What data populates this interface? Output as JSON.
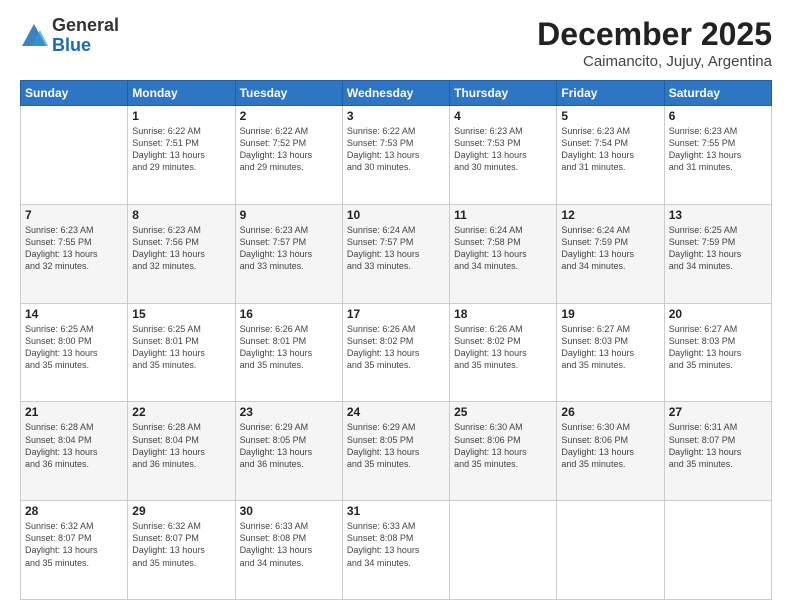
{
  "logo": {
    "general": "General",
    "blue": "Blue"
  },
  "header": {
    "month": "December 2025",
    "location": "Caimancito, Jujuy, Argentina"
  },
  "days_of_week": [
    "Sunday",
    "Monday",
    "Tuesday",
    "Wednesday",
    "Thursday",
    "Friday",
    "Saturday"
  ],
  "weeks": [
    [
      {
        "day": "",
        "info": ""
      },
      {
        "day": "1",
        "info": "Sunrise: 6:22 AM\nSunset: 7:51 PM\nDaylight: 13 hours\nand 29 minutes."
      },
      {
        "day": "2",
        "info": "Sunrise: 6:22 AM\nSunset: 7:52 PM\nDaylight: 13 hours\nand 29 minutes."
      },
      {
        "day": "3",
        "info": "Sunrise: 6:22 AM\nSunset: 7:53 PM\nDaylight: 13 hours\nand 30 minutes."
      },
      {
        "day": "4",
        "info": "Sunrise: 6:23 AM\nSunset: 7:53 PM\nDaylight: 13 hours\nand 30 minutes."
      },
      {
        "day": "5",
        "info": "Sunrise: 6:23 AM\nSunset: 7:54 PM\nDaylight: 13 hours\nand 31 minutes."
      },
      {
        "day": "6",
        "info": "Sunrise: 6:23 AM\nSunset: 7:55 PM\nDaylight: 13 hours\nand 31 minutes."
      }
    ],
    [
      {
        "day": "7",
        "info": "Sunrise: 6:23 AM\nSunset: 7:55 PM\nDaylight: 13 hours\nand 32 minutes."
      },
      {
        "day": "8",
        "info": "Sunrise: 6:23 AM\nSunset: 7:56 PM\nDaylight: 13 hours\nand 32 minutes."
      },
      {
        "day": "9",
        "info": "Sunrise: 6:23 AM\nSunset: 7:57 PM\nDaylight: 13 hours\nand 33 minutes."
      },
      {
        "day": "10",
        "info": "Sunrise: 6:24 AM\nSunset: 7:57 PM\nDaylight: 13 hours\nand 33 minutes."
      },
      {
        "day": "11",
        "info": "Sunrise: 6:24 AM\nSunset: 7:58 PM\nDaylight: 13 hours\nand 34 minutes."
      },
      {
        "day": "12",
        "info": "Sunrise: 6:24 AM\nSunset: 7:59 PM\nDaylight: 13 hours\nand 34 minutes."
      },
      {
        "day": "13",
        "info": "Sunrise: 6:25 AM\nSunset: 7:59 PM\nDaylight: 13 hours\nand 34 minutes."
      }
    ],
    [
      {
        "day": "14",
        "info": "Sunrise: 6:25 AM\nSunset: 8:00 PM\nDaylight: 13 hours\nand 35 minutes."
      },
      {
        "day": "15",
        "info": "Sunrise: 6:25 AM\nSunset: 8:01 PM\nDaylight: 13 hours\nand 35 minutes."
      },
      {
        "day": "16",
        "info": "Sunrise: 6:26 AM\nSunset: 8:01 PM\nDaylight: 13 hours\nand 35 minutes."
      },
      {
        "day": "17",
        "info": "Sunrise: 6:26 AM\nSunset: 8:02 PM\nDaylight: 13 hours\nand 35 minutes."
      },
      {
        "day": "18",
        "info": "Sunrise: 6:26 AM\nSunset: 8:02 PM\nDaylight: 13 hours\nand 35 minutes."
      },
      {
        "day": "19",
        "info": "Sunrise: 6:27 AM\nSunset: 8:03 PM\nDaylight: 13 hours\nand 35 minutes."
      },
      {
        "day": "20",
        "info": "Sunrise: 6:27 AM\nSunset: 8:03 PM\nDaylight: 13 hours\nand 35 minutes."
      }
    ],
    [
      {
        "day": "21",
        "info": "Sunrise: 6:28 AM\nSunset: 8:04 PM\nDaylight: 13 hours\nand 36 minutes."
      },
      {
        "day": "22",
        "info": "Sunrise: 6:28 AM\nSunset: 8:04 PM\nDaylight: 13 hours\nand 36 minutes."
      },
      {
        "day": "23",
        "info": "Sunrise: 6:29 AM\nSunset: 8:05 PM\nDaylight: 13 hours\nand 36 minutes."
      },
      {
        "day": "24",
        "info": "Sunrise: 6:29 AM\nSunset: 8:05 PM\nDaylight: 13 hours\nand 35 minutes."
      },
      {
        "day": "25",
        "info": "Sunrise: 6:30 AM\nSunset: 8:06 PM\nDaylight: 13 hours\nand 35 minutes."
      },
      {
        "day": "26",
        "info": "Sunrise: 6:30 AM\nSunset: 8:06 PM\nDaylight: 13 hours\nand 35 minutes."
      },
      {
        "day": "27",
        "info": "Sunrise: 6:31 AM\nSunset: 8:07 PM\nDaylight: 13 hours\nand 35 minutes."
      }
    ],
    [
      {
        "day": "28",
        "info": "Sunrise: 6:32 AM\nSunset: 8:07 PM\nDaylight: 13 hours\nand 35 minutes."
      },
      {
        "day": "29",
        "info": "Sunrise: 6:32 AM\nSunset: 8:07 PM\nDaylight: 13 hours\nand 35 minutes."
      },
      {
        "day": "30",
        "info": "Sunrise: 6:33 AM\nSunset: 8:08 PM\nDaylight: 13 hours\nand 34 minutes."
      },
      {
        "day": "31",
        "info": "Sunrise: 6:33 AM\nSunset: 8:08 PM\nDaylight: 13 hours\nand 34 minutes."
      },
      {
        "day": "",
        "info": ""
      },
      {
        "day": "",
        "info": ""
      },
      {
        "day": "",
        "info": ""
      }
    ]
  ]
}
